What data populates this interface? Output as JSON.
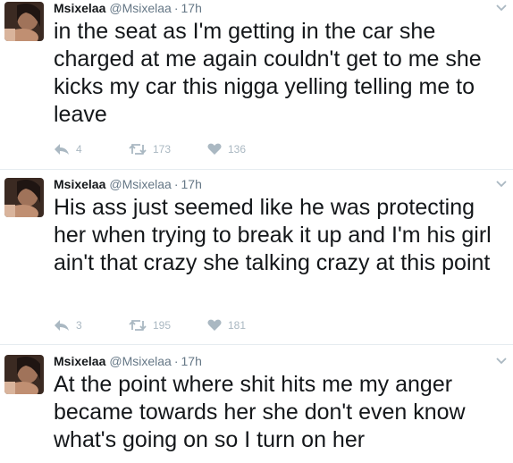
{
  "tweets": [
    {
      "fullname": "Msixelaa",
      "username": "@Msixelaa",
      "separator": "·",
      "time": "17h",
      "text": "in the seat as I'm getting in the car she charged at me again couldn't get to me she kicks my car this nigga yelling telling me to leave",
      "replies": "4",
      "retweets": "173",
      "likes": "136"
    },
    {
      "fullname": "Msixelaa",
      "username": "@Msixelaa",
      "separator": "·",
      "time": "17h",
      "text": "His ass just seemed like he was protecting her when trying to break it up and I'm his girl ain't that crazy she talking crazy at this point",
      "replies": "3",
      "retweets": "195",
      "likes": "181"
    },
    {
      "fullname": "Msixelaa",
      "username": "@Msixelaa",
      "separator": "·",
      "time": "17h",
      "text": "At the point where shit hits me my anger became towards her she don't even know what's going on so I turn on her"
    }
  ],
  "icons": {
    "avatar": "avatar-photo",
    "menu": "chevron-down-icon",
    "reply": "reply-icon",
    "retweet": "retweet-icon",
    "like": "heart-icon"
  },
  "colors": {
    "text": "#14171a",
    "secondary": "#657786",
    "action": "#aab8c2",
    "divider": "#e6ecf0"
  }
}
